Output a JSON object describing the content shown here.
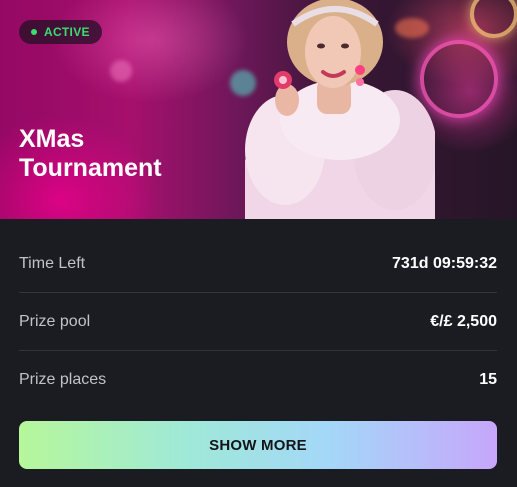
{
  "status_badge": {
    "label": "ACTIVE",
    "color": "#3ddc6e"
  },
  "tournament": {
    "title_line1": "XMas",
    "title_line2": "Tournament"
  },
  "details": [
    {
      "label": "Time Left",
      "value": "731d  09:59:32"
    },
    {
      "label": "Prize pool",
      "value": "€/£ 2,500"
    },
    {
      "label": "Prize places",
      "value": "15"
    }
  ],
  "cta": {
    "label": "SHOW MORE"
  }
}
